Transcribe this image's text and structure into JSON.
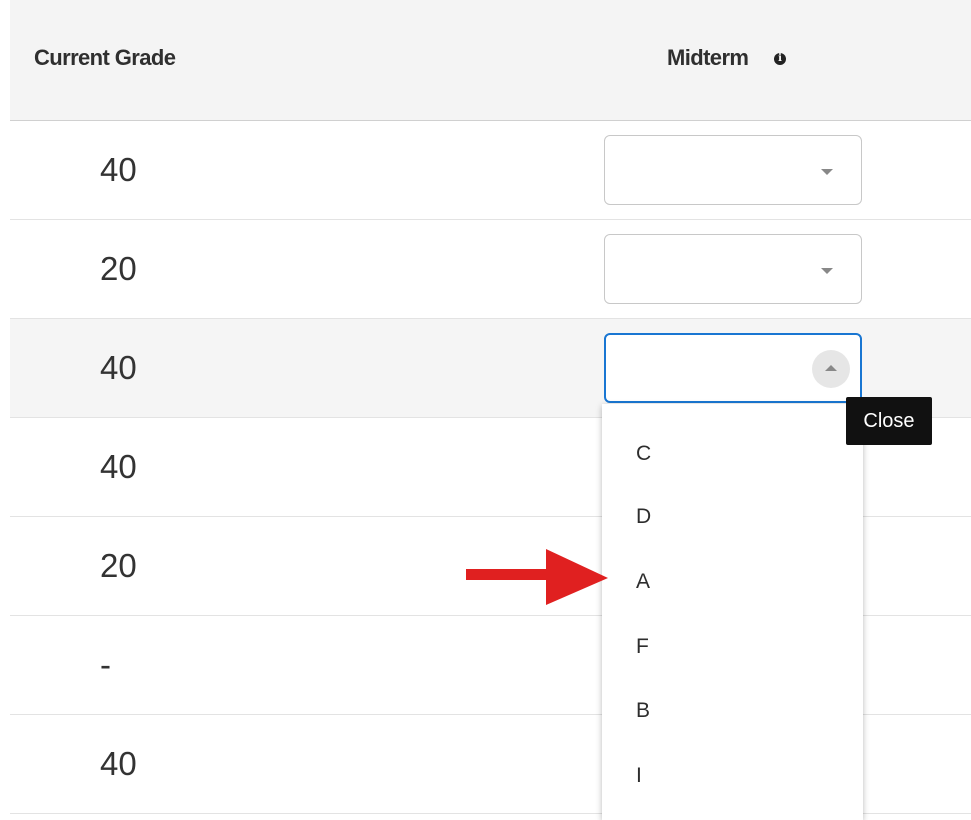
{
  "header": {
    "current_grade_label": "Current Grade",
    "midterm_label": "Midterm",
    "info_glyph": "i"
  },
  "rows": [
    {
      "grade": "40",
      "midterm": ""
    },
    {
      "grade": "20",
      "midterm": ""
    },
    {
      "grade": "40",
      "midterm": ""
    },
    {
      "grade": "40",
      "midterm": ""
    },
    {
      "grade": "20",
      "midterm": ""
    },
    {
      "grade": "-",
      "midterm": ""
    },
    {
      "grade": "40",
      "midterm": ""
    }
  ],
  "open_row_index": 2,
  "tooltip": "Close",
  "dropdown": {
    "options": [
      "C",
      "D",
      "A",
      "F",
      "B",
      "I"
    ],
    "highlighted_option": "A"
  },
  "colors": {
    "focus_border": "#1976d2",
    "annotation_arrow": "#e02020"
  },
  "icons": {
    "info": "info-icon",
    "collapsed": "chevron-down-icon",
    "expanded": "chevron-up-icon",
    "annotation": "red-arrow-icon"
  }
}
